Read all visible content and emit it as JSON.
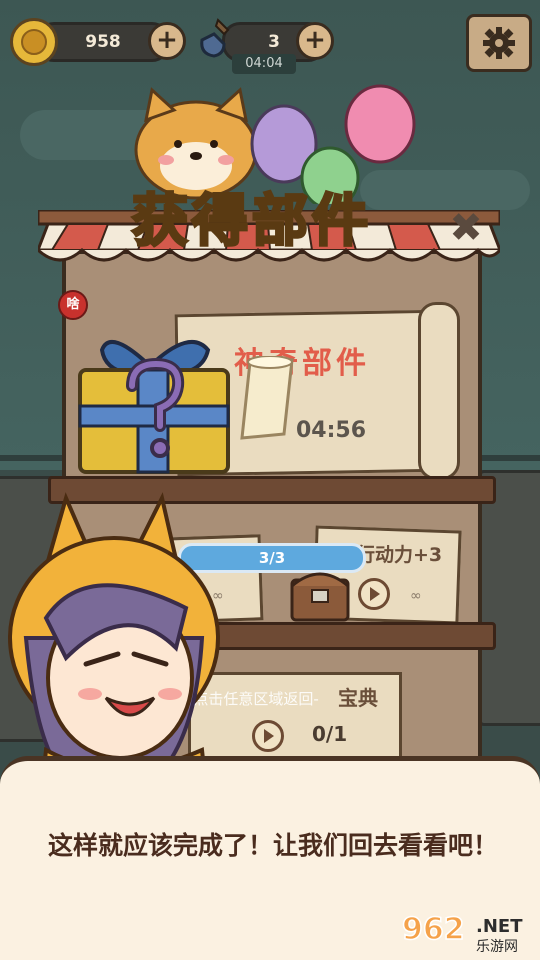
{
  "hud": {
    "coins": "958",
    "shovels": "3",
    "timer": "04:04"
  },
  "popup": {
    "title": "获得部件",
    "card_title": "神奇部件",
    "card_timer": "04:56",
    "close_label": "✖",
    "badge": "啥"
  },
  "quests": {
    "progress": "3/3",
    "infinity_left": "∞",
    "infinity_right": "∞",
    "action_power": "行动力+3",
    "bottom_label": "宝典",
    "bottom_count": "0/1"
  },
  "hint": "-点击任意区域返回-",
  "dialog": {
    "text": "这样就应该完成了！让我们回去看看吧！"
  },
  "watermark": {
    "number": "962",
    "suffix": ".NET",
    "sub": "乐游网"
  },
  "colors": {
    "title_fill": "#ffd24a",
    "card_title": "#e25d4a",
    "progress": "#5ea9de",
    "dialog_bg": "#fbf1e1"
  }
}
